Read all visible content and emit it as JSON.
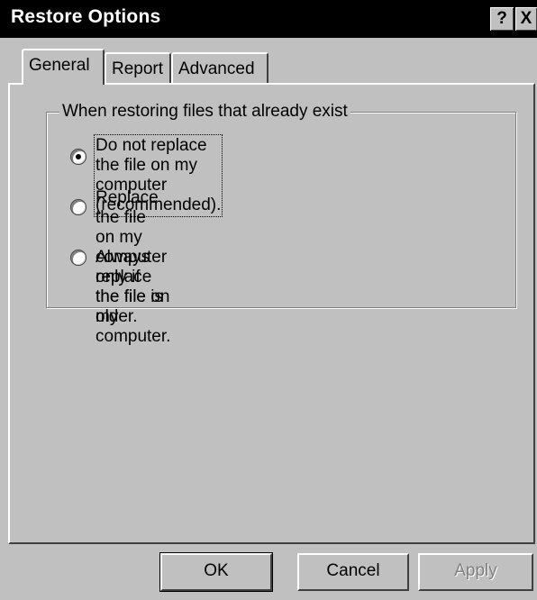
{
  "window": {
    "title": "Restore Options",
    "help_button": "?",
    "close_button": "X"
  },
  "tabs": [
    {
      "label": "General",
      "selected": true
    },
    {
      "label": "Report",
      "selected": false
    },
    {
      "label": "Advanced",
      "selected": false
    }
  ],
  "group": {
    "legend": "When restoring files that already exist",
    "options": [
      {
        "line1": "Do not replace the file on my computer",
        "line2": "(recommended).",
        "selected": true
      },
      {
        "line1": "Replace the file on my computer only if the file is",
        "line2": "older.",
        "selected": false
      },
      {
        "line1": "Always replace the file on my computer.",
        "line2": "",
        "selected": false
      }
    ]
  },
  "buttons": {
    "ok": "OK",
    "cancel": "Cancel",
    "apply": "Apply"
  }
}
